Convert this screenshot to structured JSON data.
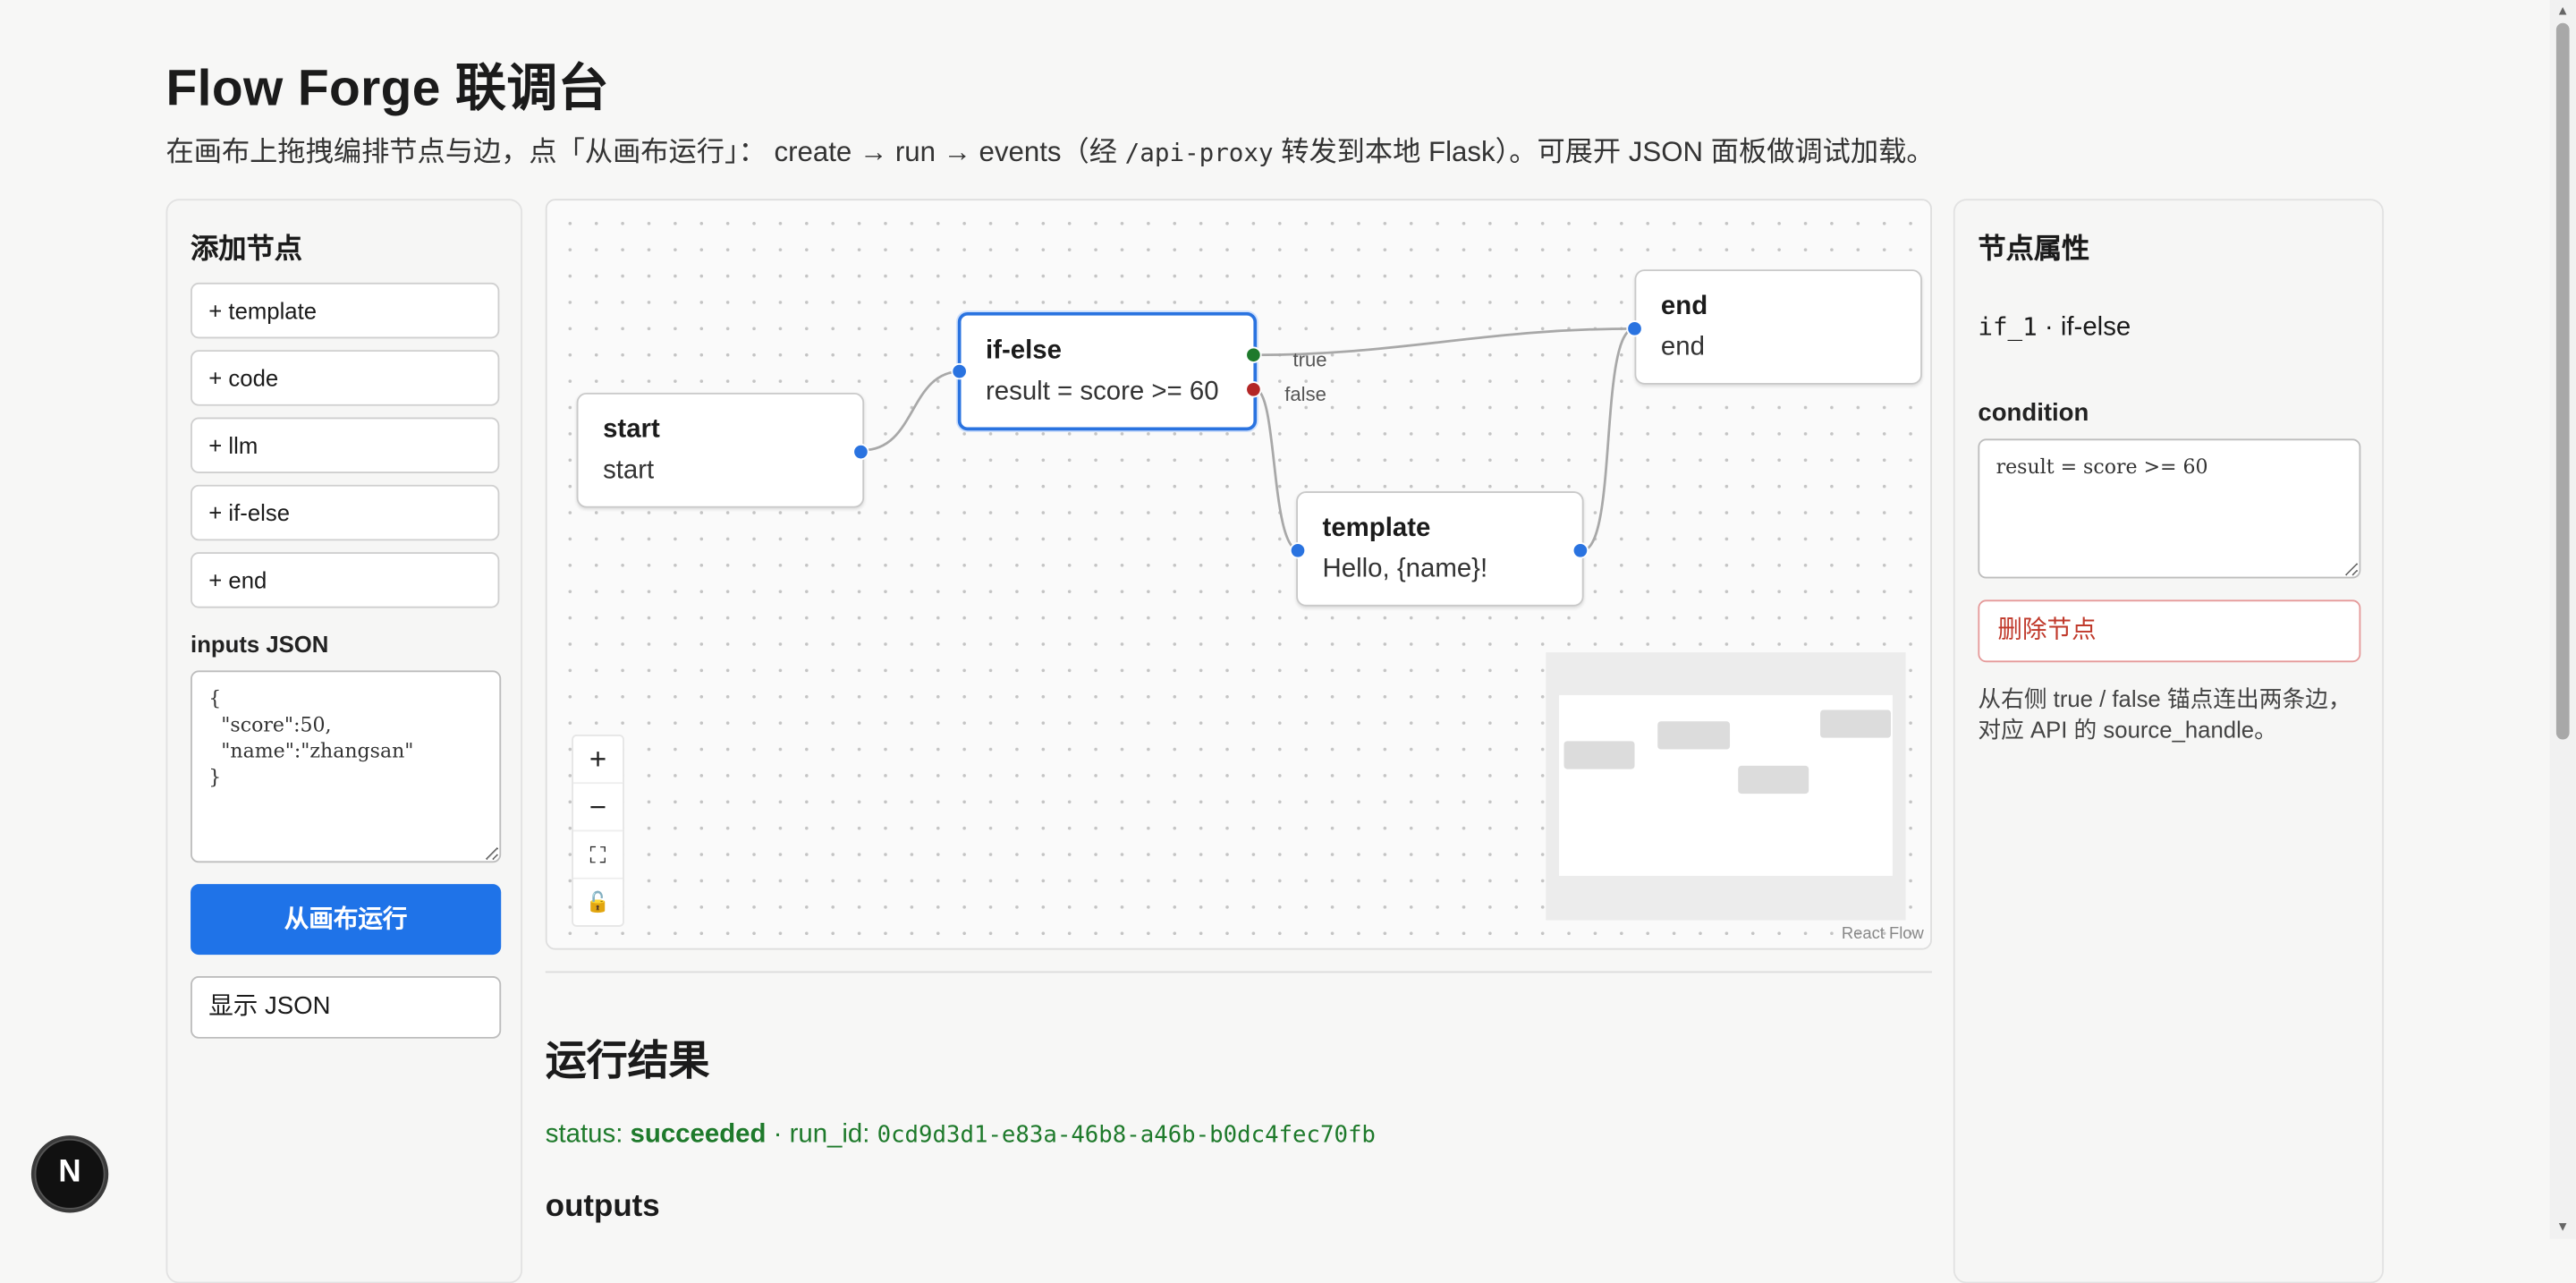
{
  "header": {
    "title": "Flow Forge 联调台",
    "subtitle_a": "在画布上拖拽编排节点与边，点「从画布运行」：  create → run → events（经 ",
    "subtitle_code": "/api-proxy",
    "subtitle_b": " 转发到本地 Flask）。可展开 JSON 面板做调试加载。"
  },
  "left_panel": {
    "title": "添加节点",
    "add_buttons": [
      "+ template",
      "+ code",
      "+ llm",
      "+ if-else",
      "+ end"
    ],
    "inputs_label": "inputs JSON",
    "inputs_value": "{\n  \"score\":50,\n  \"name\":\"zhangsan\"\n}",
    "run_button": "从画布运行",
    "json_button": "显示 JSON"
  },
  "canvas": {
    "nodes": [
      {
        "title": "start",
        "body": "start"
      },
      {
        "title": "if-else",
        "body": "result = score >= 60"
      },
      {
        "title": "end",
        "body": "end"
      },
      {
        "title": "template",
        "body": "Hello, {name}!"
      }
    ],
    "edge_labels": {
      "true": "true",
      "false": "false"
    },
    "controls": {
      "zoom_in": "+",
      "zoom_out": "−",
      "fit": "⛶",
      "lock": "🔓"
    },
    "attribution": "React Flow",
    "colors": {
      "true_handle": "#1e7a2b",
      "false_handle": "#b32626",
      "handle": "#2a73e0"
    }
  },
  "result": {
    "title": "运行结果",
    "status_label": "status: ",
    "status_value": "succeeded",
    "run_id_label": " · run_id: ",
    "run_id": "0cd9d3d1-e83a-46b8-a46b-b0dc4fec70fb",
    "outputs_label": "outputs"
  },
  "right_panel": {
    "title": "节点属性",
    "node_id": "if_1",
    "node_type": " · if-else",
    "condition_label": "condition",
    "condition_value": "result = score >= 60",
    "delete_button": "删除节点",
    "hint": "从右侧 true / false 锚点连出两条边，对应 API 的 source_handle。"
  },
  "badge": "N"
}
